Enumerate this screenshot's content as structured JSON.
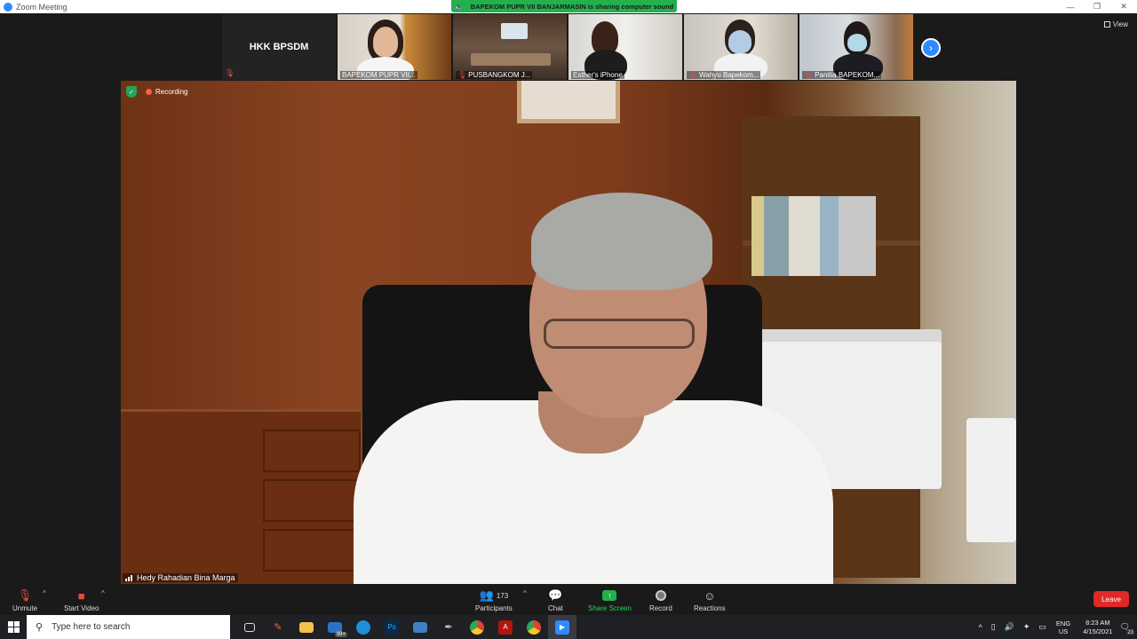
{
  "window": {
    "title": "Zoom Meeting",
    "minimize": "—",
    "maximize": "❐",
    "close": "✕"
  },
  "share_banner": "BAPEKOM PUPR VII BANJARMASIN is sharing computer sound",
  "view_label": "View",
  "participants_strip": [
    {
      "name": "HKK BPSDM",
      "video": false
    },
    {
      "name": "BAPEKOM PUPR VII..."
    },
    {
      "name": "PUSBANGKOM J..."
    },
    {
      "name": "Esther's iPhone"
    },
    {
      "name": "Wahyu Bapekom..."
    },
    {
      "name": "Panitia BAPEKOM..."
    }
  ],
  "recording_label": "Recording",
  "active_speaker": "Hedy Rahadian Bina Marga",
  "toolbar": {
    "unmute": "Unmute",
    "start_video": "Start Video",
    "participants": "Participants",
    "participants_count": "173",
    "chat": "Chat",
    "share_screen": "Share Screen",
    "record": "Record",
    "reactions": "Reactions",
    "leave": "Leave"
  },
  "taskbar": {
    "search_placeholder": "Type here to search",
    "mail_badge": "99+",
    "lang_top": "ENG",
    "lang_bottom": "US",
    "time": "8:23 AM",
    "date": "4/15/2021",
    "notifications": "23"
  },
  "colors": {
    "zoom_blue": "#2d8cff",
    "share_green": "#23b14c",
    "leave_red": "#e02828"
  }
}
